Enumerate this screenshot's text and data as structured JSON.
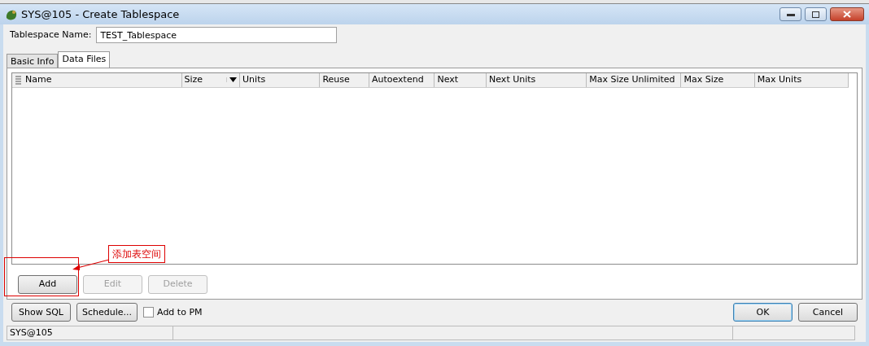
{
  "window": {
    "title": "SYS@105 - Create Tablespace"
  },
  "name_field": {
    "label": "Tablespace Name:",
    "value": "TEST_Tablespace"
  },
  "tabs": [
    {
      "label": "Basic Info",
      "selected": false
    },
    {
      "label": "Data Files",
      "selected": true
    }
  ],
  "table": {
    "columns": [
      {
        "label": "Name",
        "sort_menu": false
      },
      {
        "label": "Size",
        "sort_menu": true
      },
      {
        "label": "Units",
        "sort_menu": false
      },
      {
        "label": "Reuse",
        "sort_menu": false
      },
      {
        "label": "Autoextend",
        "sort_menu": false
      },
      {
        "label": "Next",
        "sort_menu": false
      },
      {
        "label": "Next Units",
        "sort_menu": false
      },
      {
        "label": "Max Size Unlimited",
        "sort_menu": false
      },
      {
        "label": "Max Size",
        "sort_menu": false
      },
      {
        "label": "Max Units",
        "sort_menu": false
      }
    ]
  },
  "file_buttons": [
    {
      "label": "Add",
      "disabled": false
    },
    {
      "label": "Edit",
      "disabled": true
    },
    {
      "label": "Delete",
      "disabled": true
    }
  ],
  "annotation": {
    "text": "添加表空间"
  },
  "footer": {
    "left_buttons": [
      {
        "label": "Show SQL"
      },
      {
        "label": "Schedule..."
      }
    ],
    "add_to_pm": {
      "label": "Add to PM",
      "checked": false
    },
    "right_buttons": [
      {
        "label": "OK",
        "default": true
      },
      {
        "label": "Cancel",
        "default": false
      }
    ]
  },
  "status_bar": {
    "text": "SYS@105"
  }
}
